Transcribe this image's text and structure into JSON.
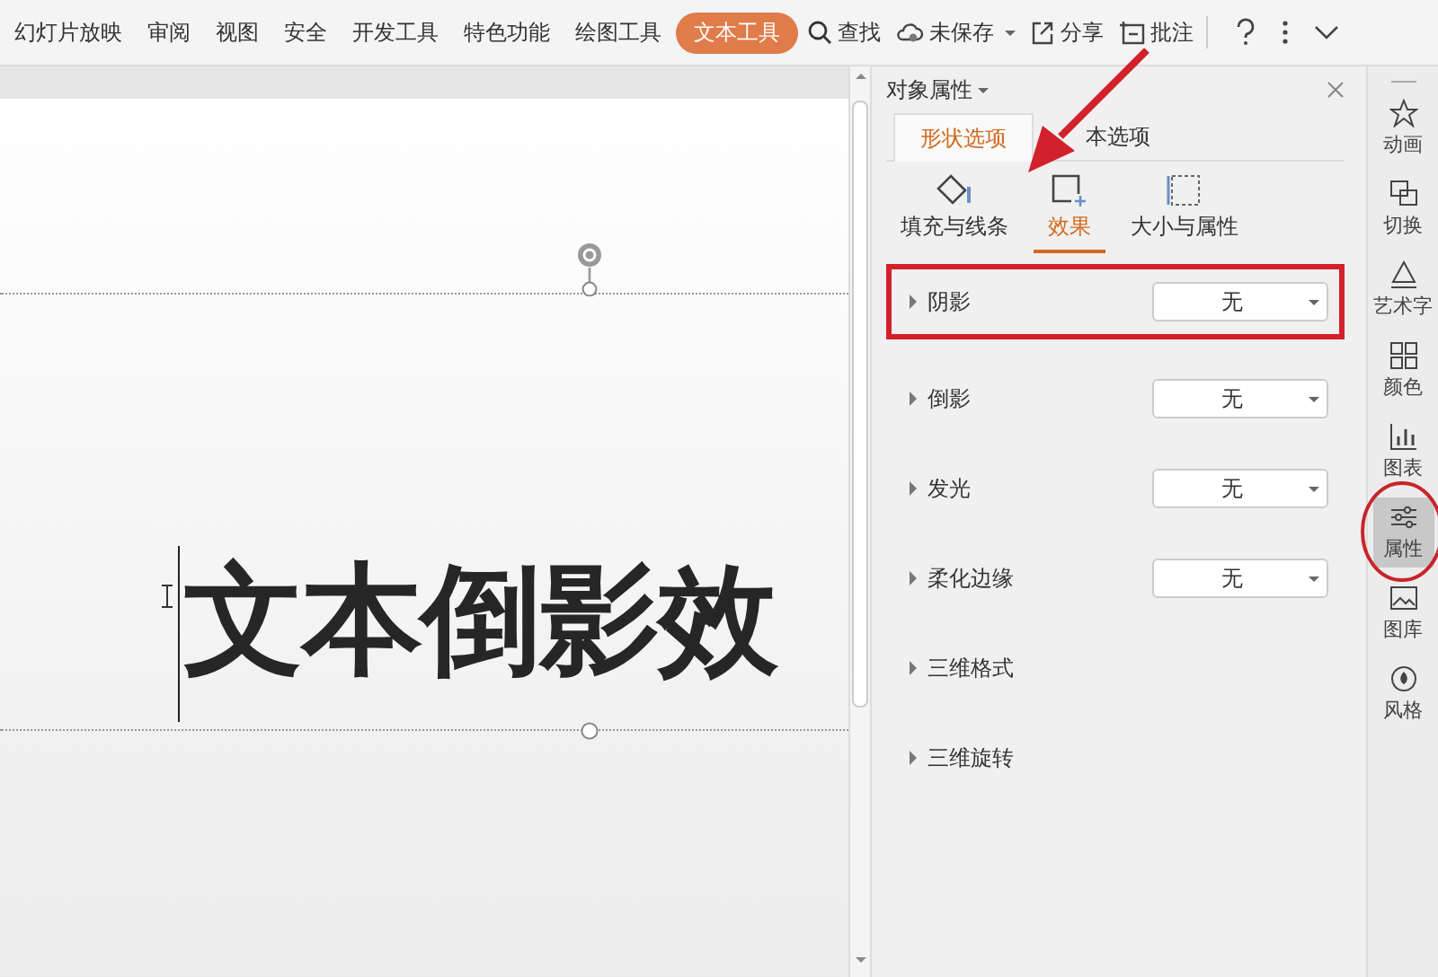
{
  "menu_tabs": [
    {
      "label": "幻灯片放映",
      "selected": false
    },
    {
      "label": "审阅",
      "selected": false
    },
    {
      "label": "视图",
      "selected": false
    },
    {
      "label": "安全",
      "selected": false
    },
    {
      "label": "开发工具",
      "selected": false
    },
    {
      "label": "特色功能",
      "selected": false
    },
    {
      "label": "绘图工具",
      "selected": false
    },
    {
      "label": "文本工具",
      "selected": true
    }
  ],
  "toolbar_actions": [
    {
      "kind": "search",
      "label": "查找",
      "has_menu": false
    },
    {
      "kind": "cloud",
      "label": "未保存",
      "has_menu": true
    },
    {
      "kind": "share",
      "label": "分享",
      "has_menu": false
    },
    {
      "kind": "comment",
      "label": "批注",
      "has_menu": false
    }
  ],
  "slide": {
    "text": "文本倒影效"
  },
  "panel": {
    "title": "对象属性",
    "tabs": [
      {
        "label": "形状选项",
        "selected": true
      },
      {
        "label": "本选项",
        "selected": false
      }
    ],
    "subtabs": [
      {
        "label": "填充与线条",
        "selected": false
      },
      {
        "label": "效果",
        "selected": true
      },
      {
        "label": "大小与属性",
        "selected": false
      }
    ],
    "properties": [
      {
        "kind": "select",
        "label": "阴影",
        "value": "无",
        "highlighted": true
      },
      {
        "kind": "select",
        "label": "倒影",
        "value": "无",
        "highlighted": false
      },
      {
        "kind": "select",
        "label": "发光",
        "value": "无",
        "highlighted": false
      },
      {
        "kind": "select",
        "label": "柔化边缘",
        "value": "无",
        "highlighted": false
      },
      {
        "kind": "section",
        "label": "三维格式",
        "highlighted": false
      },
      {
        "kind": "section",
        "label": "三维旋转",
        "highlighted": false
      }
    ]
  },
  "sidebar": [
    {
      "label": "动画",
      "selected": false,
      "circled": false
    },
    {
      "label": "切换",
      "selected": false,
      "circled": false
    },
    {
      "label": "艺术字",
      "selected": false,
      "circled": false
    },
    {
      "label": "颜色",
      "selected": false,
      "circled": false
    },
    {
      "label": "图表",
      "selected": false,
      "circled": false
    },
    {
      "label": "属性",
      "selected": true,
      "circled": true
    },
    {
      "label": "图库",
      "selected": false,
      "circled": false
    },
    {
      "label": "风格",
      "selected": false,
      "circled": false
    }
  ]
}
